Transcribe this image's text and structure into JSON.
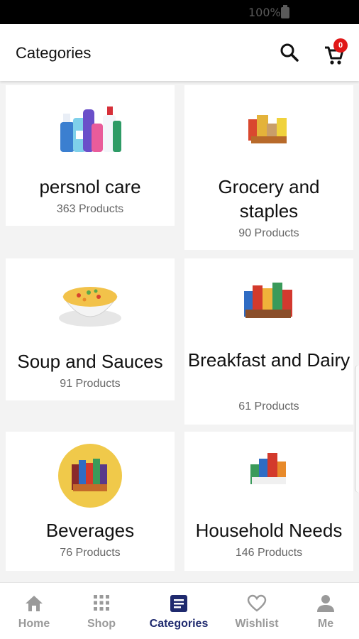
{
  "status_bar": {
    "battery_text": "100%"
  },
  "header": {
    "title": "Categories",
    "cart_count": "0"
  },
  "categories": [
    {
      "name": "persnol care",
      "count": "363 Products"
    },
    {
      "name": "Grocery and staples",
      "count": "90 Products"
    },
    {
      "name": "Soup and Sauces",
      "count": "91 Products"
    },
    {
      "name": "Breakfast and Dairy",
      "count": "61 Products"
    },
    {
      "name": "Beverages",
      "count": "76 Products"
    },
    {
      "name": "Household Needs",
      "count": "146 Products"
    }
  ],
  "nav": [
    {
      "label": "Home",
      "icon": "home-icon"
    },
    {
      "label": "Shop",
      "icon": "grid-icon"
    },
    {
      "label": "Categories",
      "icon": "list-icon",
      "active": true
    },
    {
      "label": "Wishlist",
      "icon": "heart-icon"
    },
    {
      "label": "Me",
      "icon": "person-icon"
    }
  ],
  "colors": {
    "active_nav": "#1f2a6e",
    "inactive_nav": "#9a9a9a",
    "badge": "#e01818"
  }
}
